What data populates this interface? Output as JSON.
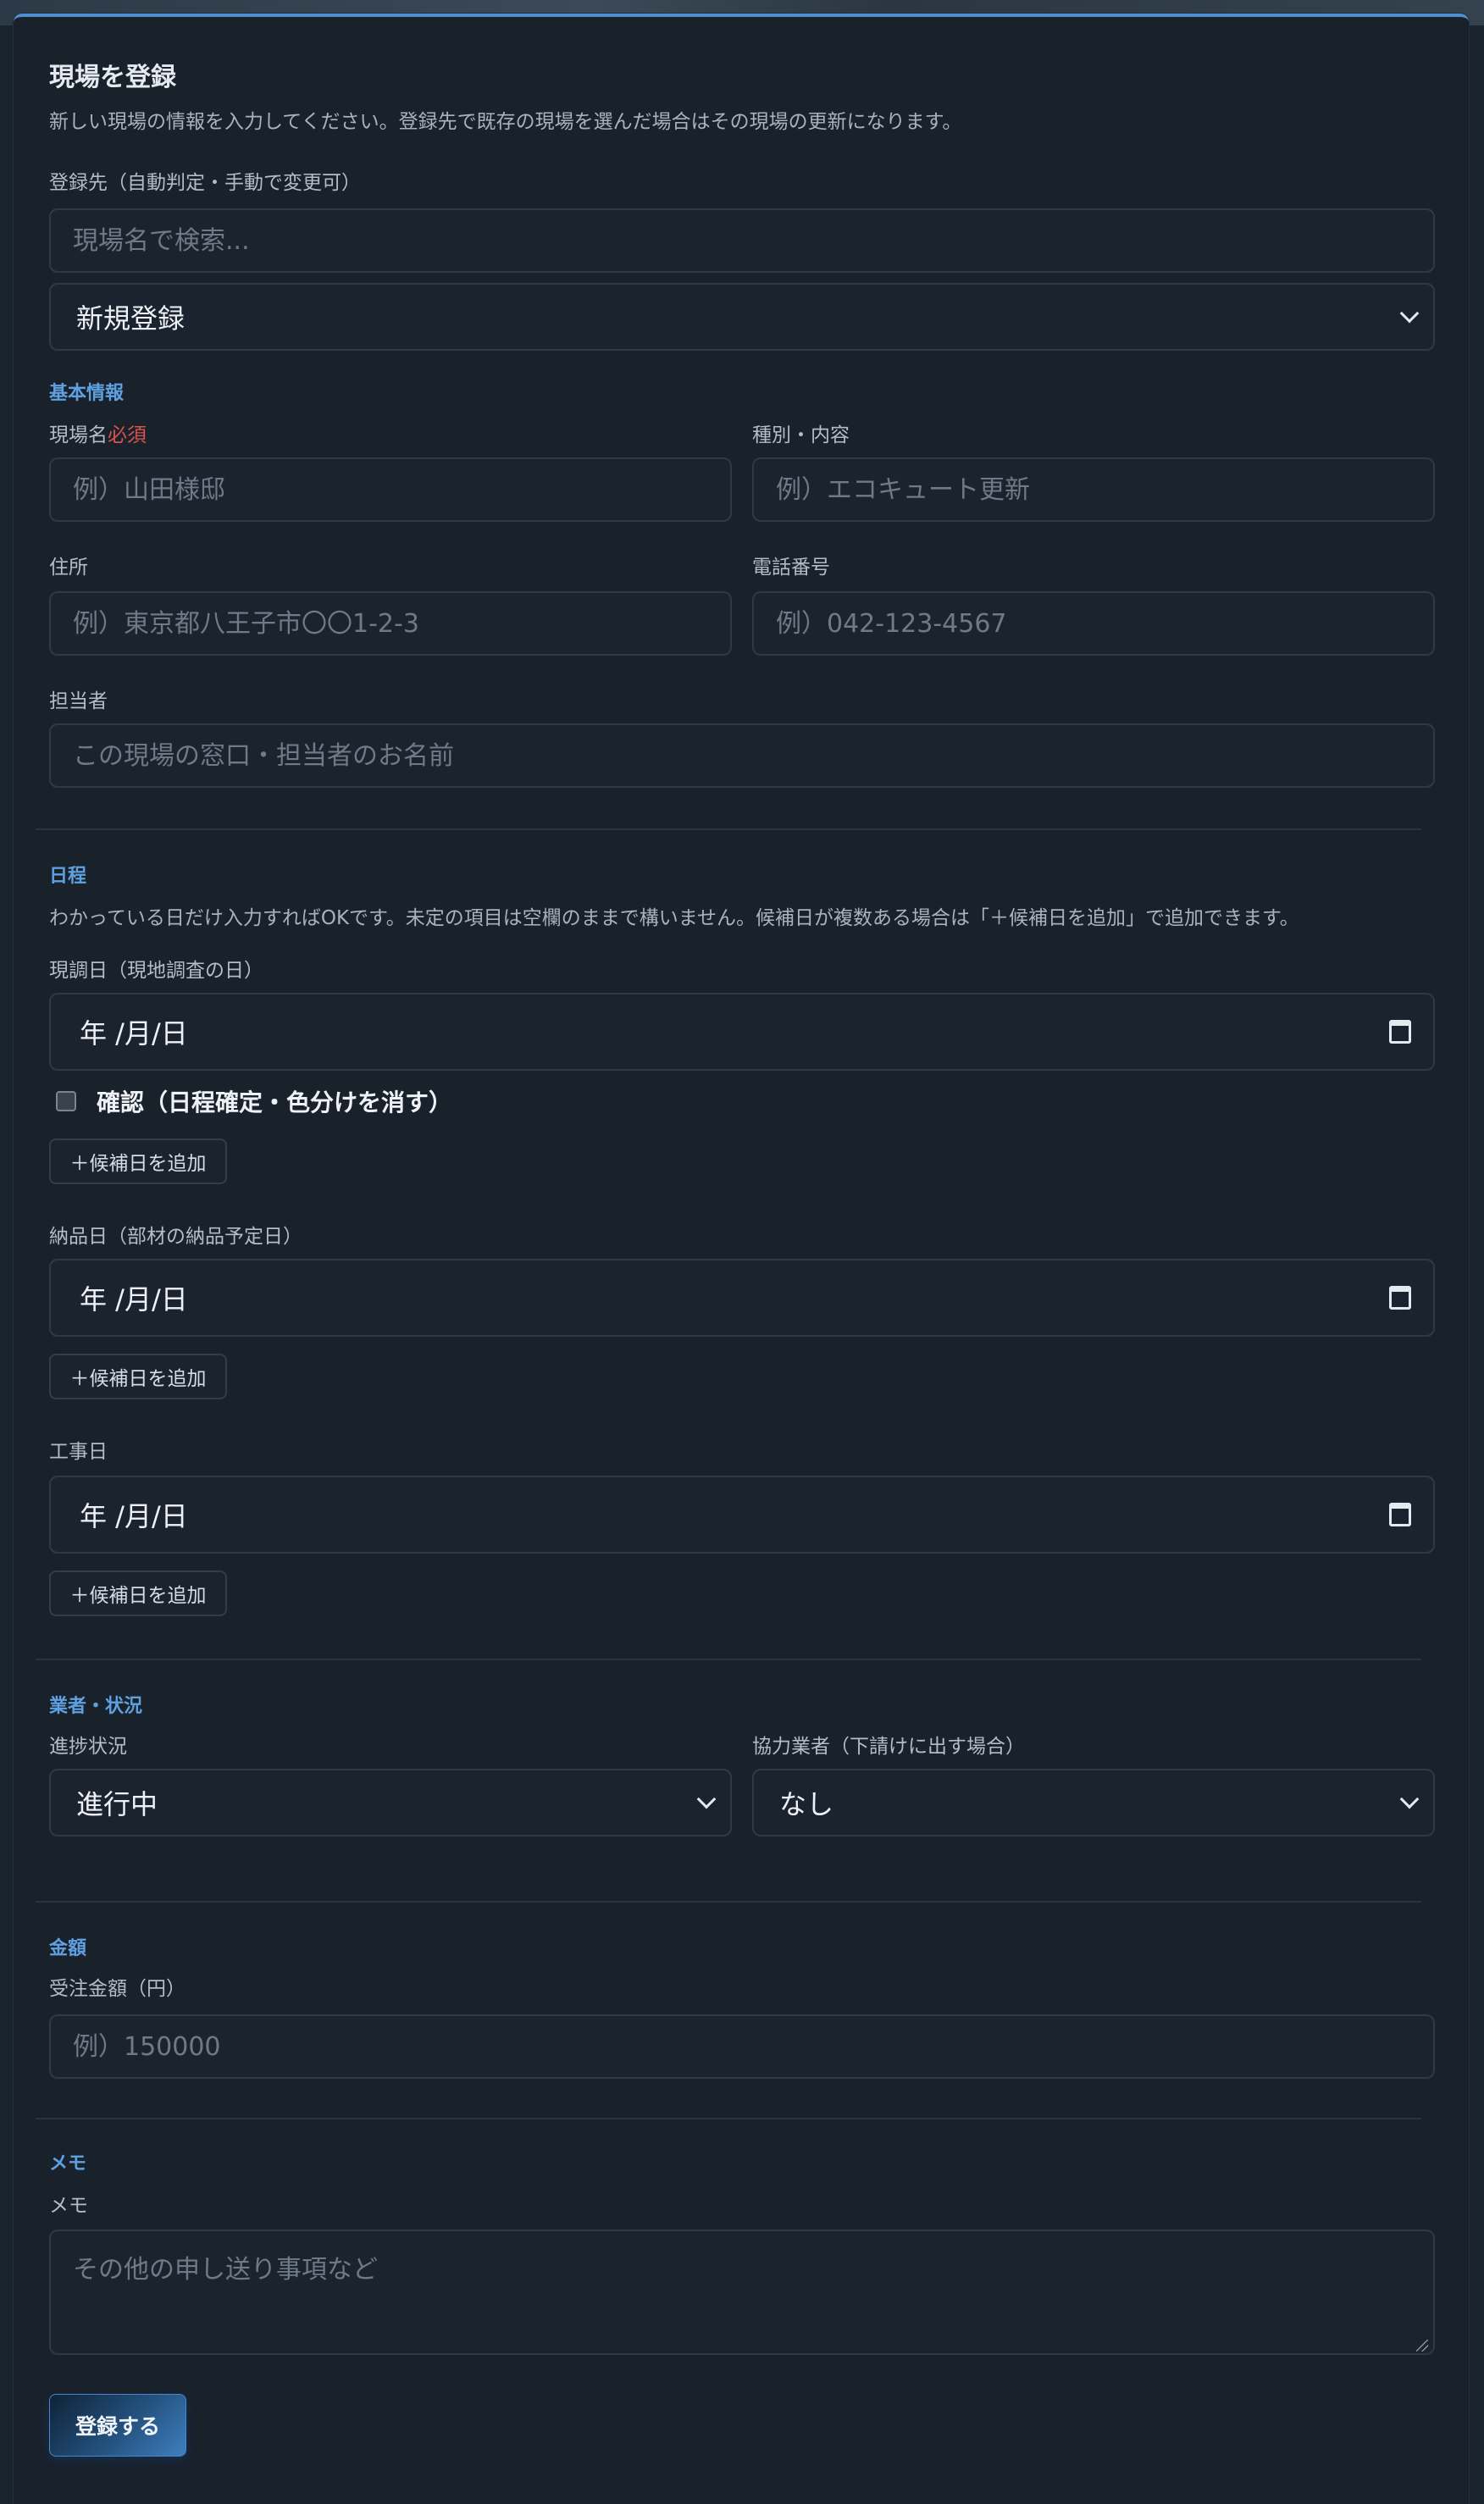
{
  "header": {
    "title": "現場を登録",
    "description": "新しい現場の情報を入力してください。登録先で既存の現場を選んだ場合はその現場の更新になります。"
  },
  "target": {
    "label": "登録先（自動判定・手動で変更可）",
    "search_placeholder": "現場名で検索...",
    "select_value": "新規登録"
  },
  "basic": {
    "section_title": "基本情報",
    "site_name_label": "現場名",
    "required_mark": "必須",
    "site_name_placeholder": "例）山田様邸",
    "type_label": "種別・内容",
    "type_placeholder": "例）エコキュート更新",
    "address_label": "住所",
    "address_placeholder": "例）東京都八王子市〇〇1-2-3",
    "phone_label": "電話番号",
    "phone_placeholder": "例）042-123-4567",
    "contact_label": "担当者",
    "contact_placeholder": "この現場の窓口・担当者のお名前"
  },
  "schedule": {
    "section_title": "日程",
    "note": "わかっている日だけ入力すればOKです。未定の項目は空欄のままで構いません。候補日が複数ある場合は「＋候補日を追加」で追加できます。",
    "survey_label": "現調日（現地調査の日）",
    "date_placeholder": "年 /月/日",
    "confirm_label": "確認（日程確定・色分けを消す）",
    "add_candidate": "＋候補日を追加",
    "delivery_label": "納品日（部材の納品予定日）",
    "construction_label": "工事日"
  },
  "vendor": {
    "section_title": "業者・状況",
    "progress_label": "進捗状況",
    "progress_value": "進行中",
    "partner_label": "協力業者（下請けに出す場合）",
    "partner_value": "なし"
  },
  "amount": {
    "section_title": "金額",
    "order_label": "受注金額（円）",
    "order_placeholder": "例）150000"
  },
  "memo": {
    "section_title": "メモ",
    "label": "メモ",
    "placeholder": "その他の申し送り事項など"
  },
  "actions": {
    "submit_label": "登録する"
  },
  "colors": {
    "accent": "#5ea0e0",
    "required": "#d9534f",
    "background": "#19212b"
  }
}
